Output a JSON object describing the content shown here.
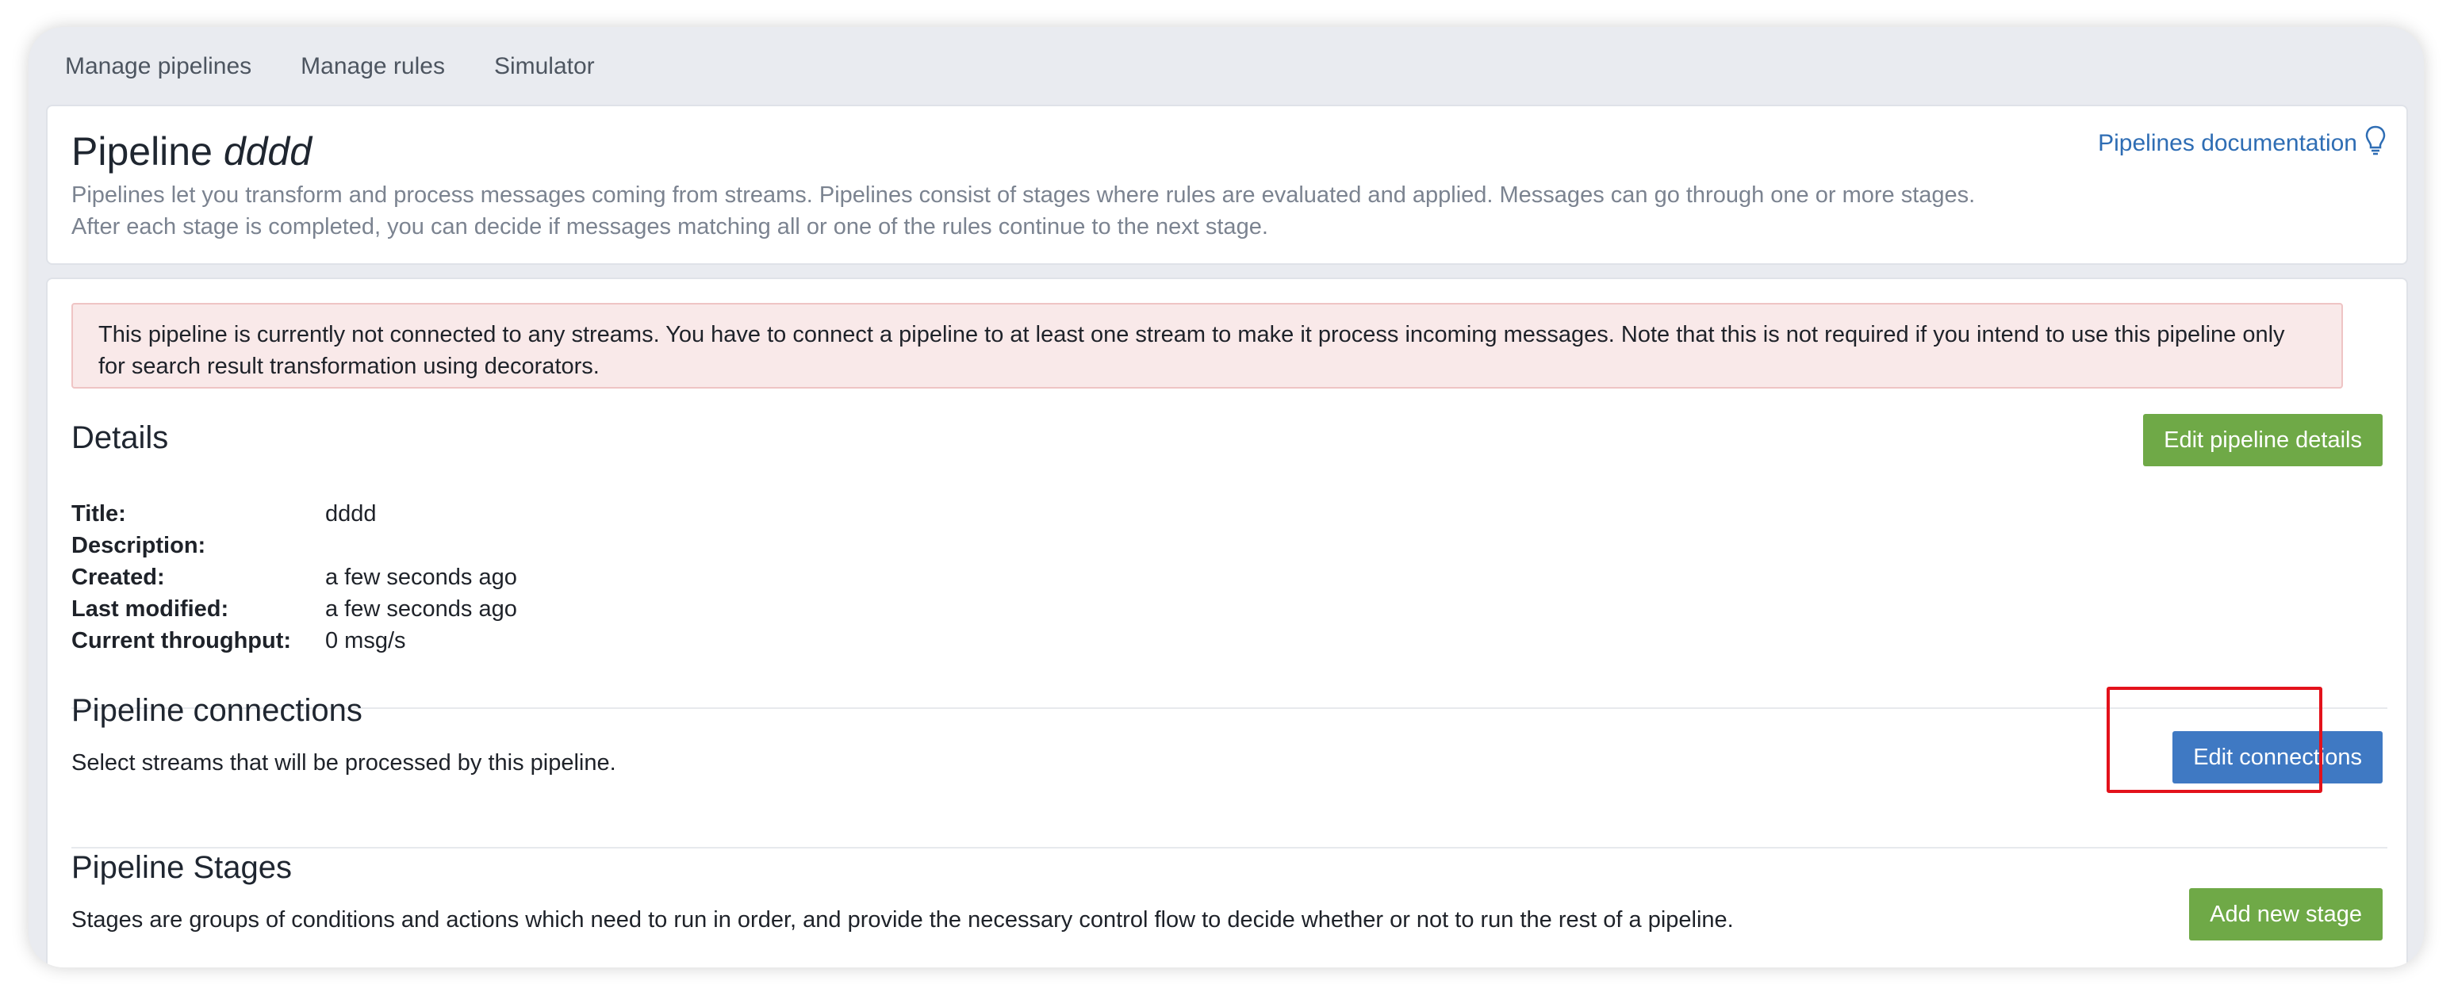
{
  "nav": {
    "items": [
      "Manage pipelines",
      "Manage rules",
      "Simulator"
    ]
  },
  "header": {
    "title_prefix": "Pipeline",
    "title_name": "dddd",
    "desc_line1": "Pipelines let you transform and process messages coming from streams. Pipelines consist of stages where rules are evaluated and applied. Messages can go through one or more stages.",
    "desc_line2": "After each stage is completed, you can decide if messages matching all or one of the rules continue to the next stage.",
    "docs_link": "Pipelines documentation",
    "docs_icon": "lightbulb-icon"
  },
  "alert": {
    "line1": "This pipeline is currently not connected to any streams. You have to connect a pipeline to at least one stream to make it process incoming messages. Note that this is not required if you intend to use this pipeline only",
    "line2": "for search result transformation using decorators."
  },
  "details": {
    "title": "Details",
    "edit_button": "Edit pipeline details",
    "rows": [
      {
        "label": "Title:",
        "value": "dddd"
      },
      {
        "label": "Description:",
        "value": ""
      },
      {
        "label": "Created:",
        "value": "a few seconds ago"
      },
      {
        "label": "Last modified:",
        "value": "a few seconds ago"
      },
      {
        "label": "Current throughput:",
        "value": "0 msg/s"
      }
    ]
  },
  "connections": {
    "title": "Pipeline connections",
    "desc": "Select streams that will be processed by this pipeline.",
    "edit_button": "Edit connections"
  },
  "stages": {
    "title": "Pipeline Stages",
    "desc": "Stages are groups of conditions and actions which need to run in order, and provide the necessary control flow to decide whether or not to run the rest of a pipeline.",
    "add_button": "Add new stage"
  },
  "colors": {
    "green_button": "#6fa947",
    "blue_button": "#3f79c3",
    "alert_bg": "#f9e9e9",
    "link": "#2e6db4",
    "highlight": "#e3121b"
  }
}
